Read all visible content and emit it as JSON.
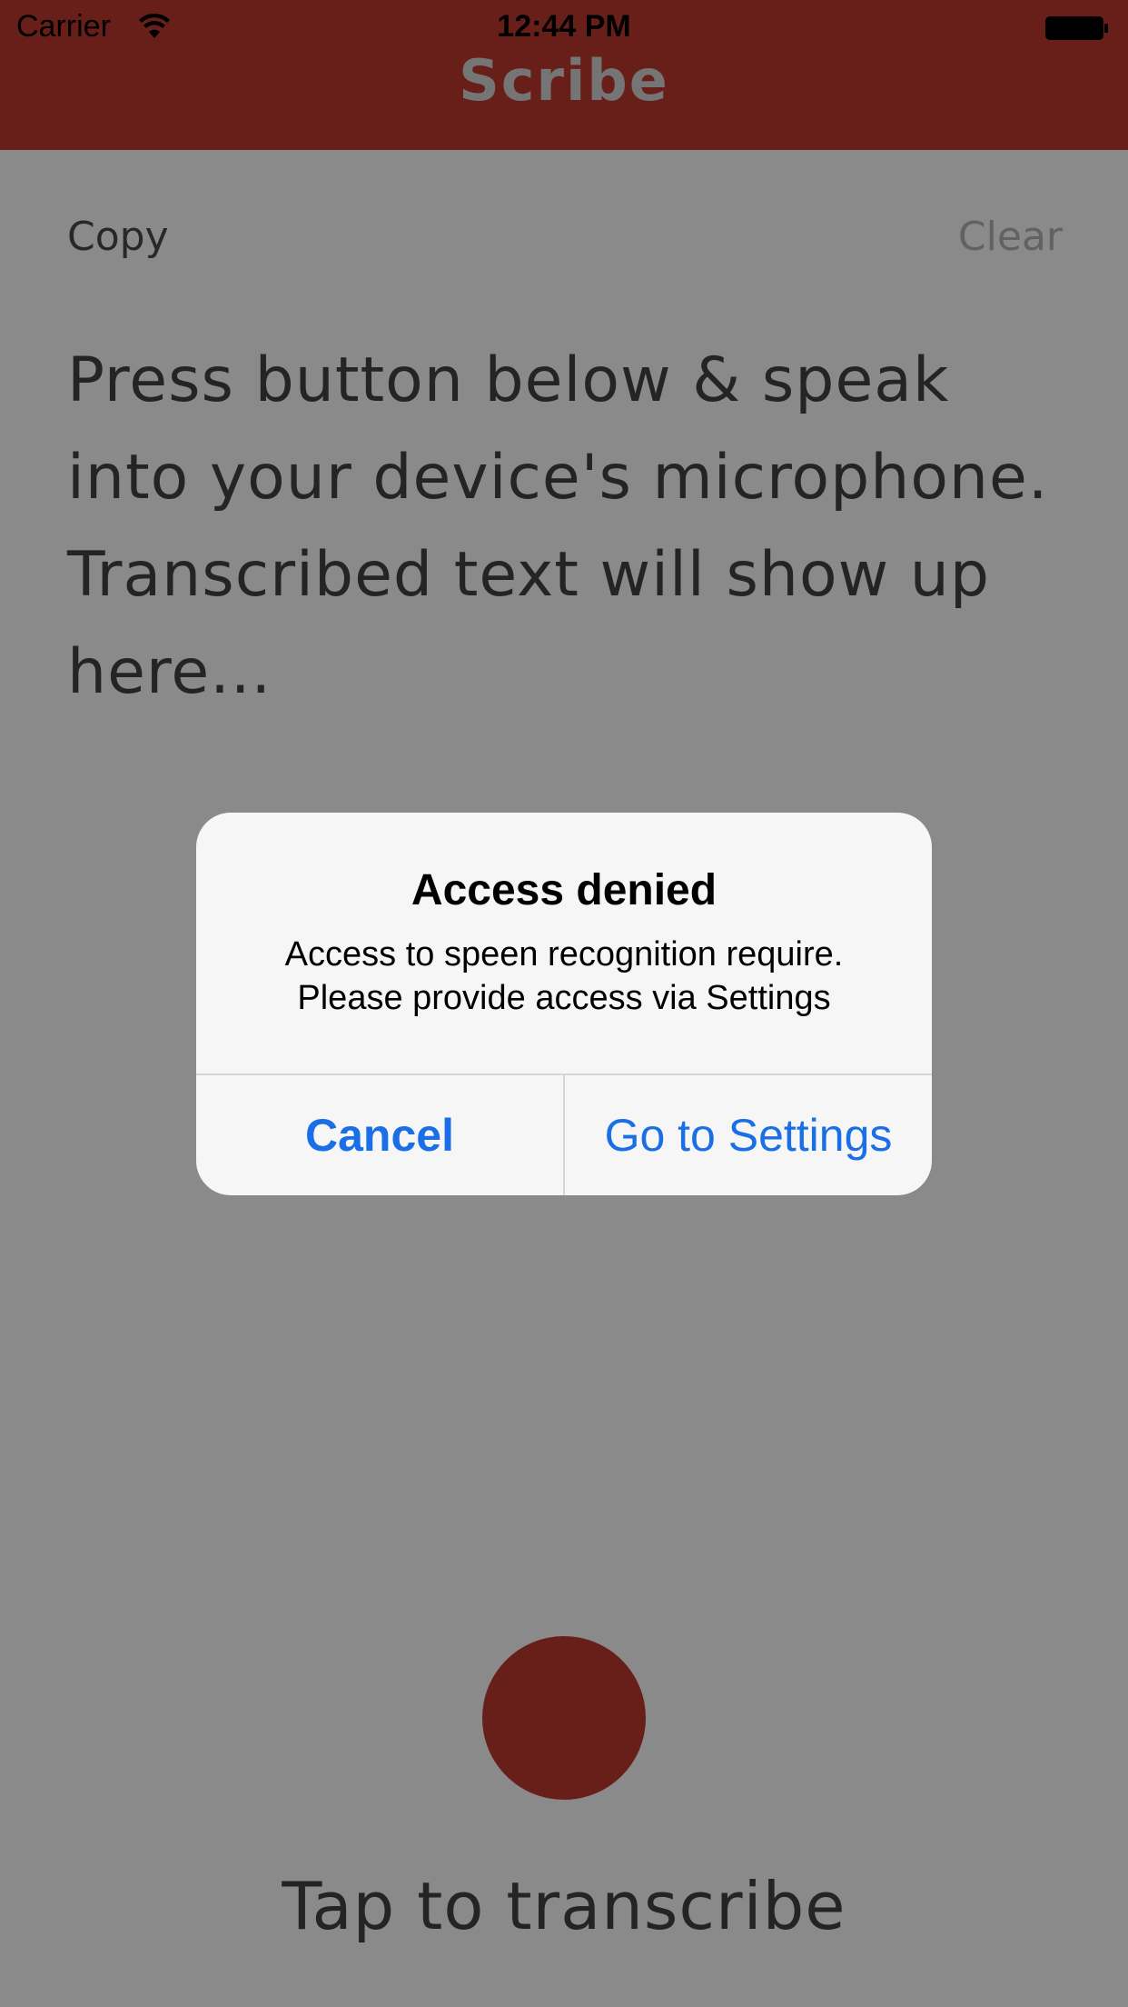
{
  "status_bar": {
    "carrier": "Carrier",
    "time": "12:44 PM",
    "wifi_icon": "wifi-icon",
    "battery_icon": "battery-icon"
  },
  "header": {
    "title": "Scribe",
    "color": "#c0392f"
  },
  "toolbar": {
    "copy_label": "Copy",
    "clear_label": "Clear"
  },
  "main": {
    "placeholder": "Press button below & speak into your device's microphone. Transcribed text will show up here...",
    "tap_label": "Tap to transcribe"
  },
  "alert": {
    "title": "Access denied",
    "message_line1": "Access to speen recognition require.",
    "message_line2": "Please provide access via Settings",
    "cancel_label": "Cancel",
    "settings_label": "Go to Settings",
    "accent": "#1a6fe6"
  }
}
